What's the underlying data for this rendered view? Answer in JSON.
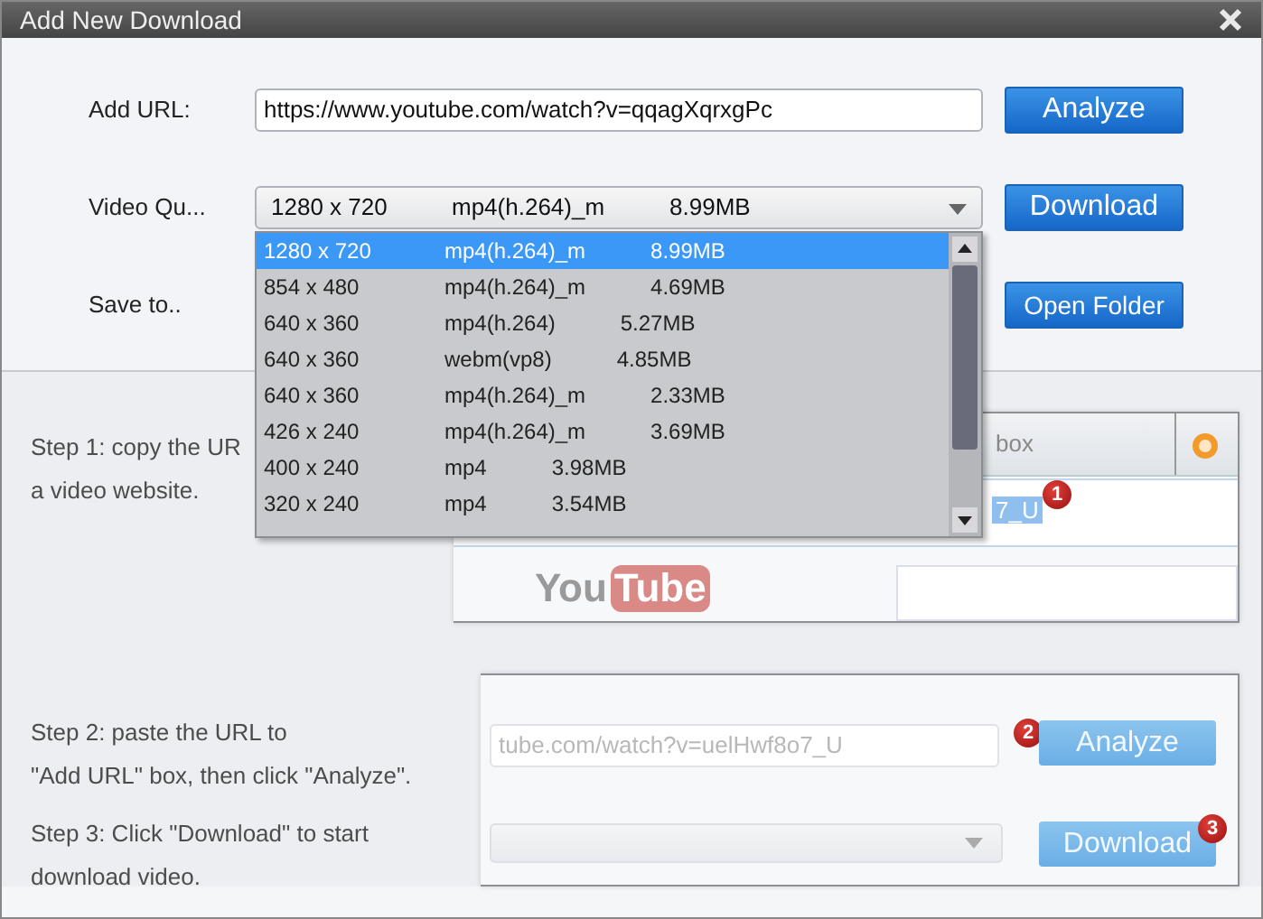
{
  "window": {
    "title": "Add New Download"
  },
  "form": {
    "url_label": "Add URL:",
    "url_value": "https://www.youtube.com/watch?v=qqagXqrxgPc",
    "analyze": "Analyze",
    "quality_label": "Video Qu...",
    "quality_value": {
      "resolution": "1280 x 720",
      "format": "mp4(h.264)_m",
      "size": "8.99MB"
    },
    "download": "Download",
    "save_label": "Save to..",
    "open_folder": "Open Folder"
  },
  "quality_options": [
    {
      "resolution": "1280 x 720",
      "format": "mp4(h.264)_m",
      "size": "8.99MB",
      "selected": true
    },
    {
      "resolution": "854 x 480",
      "format": "mp4(h.264)_m",
      "size": "4.69MB",
      "selected": false
    },
    {
      "resolution": "640 x 360",
      "format": "mp4(h.264)",
      "size": "5.27MB",
      "selected": false
    },
    {
      "resolution": "640 x 360",
      "format": "webm(vp8)",
      "size": "4.85MB",
      "selected": false
    },
    {
      "resolution": "640 x 360",
      "format": "mp4(h.264)_m",
      "size": "2.33MB",
      "selected": false
    },
    {
      "resolution": "426 x 240",
      "format": "mp4(h.264)_m",
      "size": "3.69MB",
      "selected": false
    },
    {
      "resolution": "400 x 240",
      "format": "mp4",
      "size": "3.98MB",
      "selected": false
    },
    {
      "resolution": "320 x 240",
      "format": "mp4",
      "size": "3.54MB",
      "selected": false
    }
  ],
  "tutorial": {
    "steps": [
      {
        "lines": [
          "Step 1: copy the UR",
          "a video website."
        ]
      },
      {
        "lines": [
          "Step 2: paste the URL to",
          "\"Add URL\" box, then click \"Analyze\"."
        ]
      },
      {
        "lines": [
          "Step 3: Click \"Download\" to start",
          "download video."
        ]
      }
    ],
    "illustration": {
      "tab": "box",
      "url_fragment": "7_U",
      "logo": [
        "You",
        "Tube"
      ],
      "url_text": "tube.com/watch?v=uelHwf8o7_U",
      "analyze": "Analyze",
      "download": "Download",
      "badges": [
        "1",
        "2",
        "3"
      ]
    }
  }
}
